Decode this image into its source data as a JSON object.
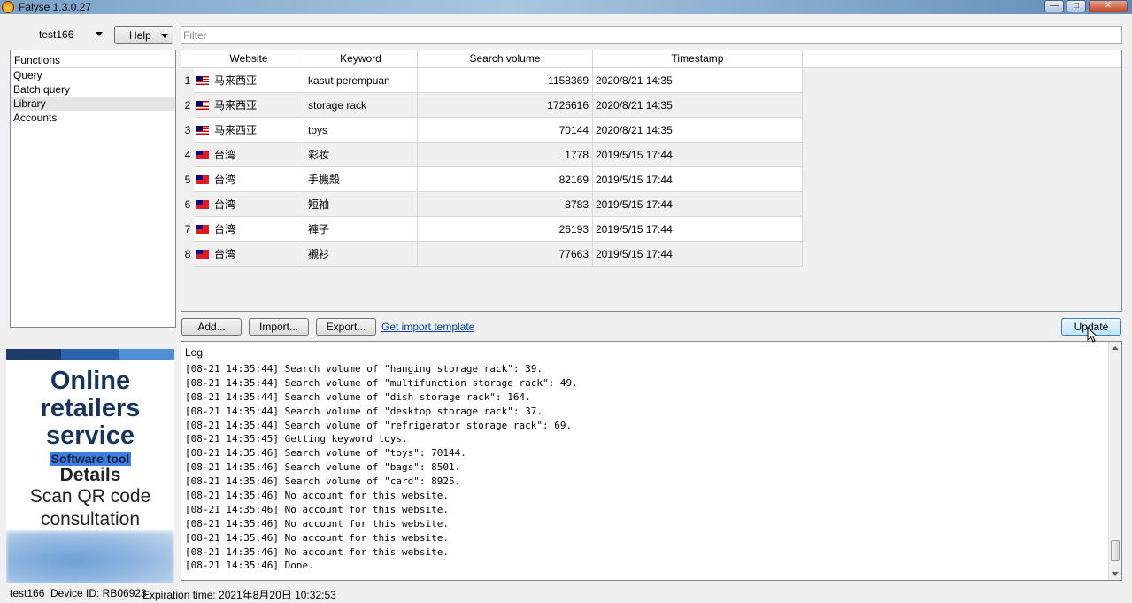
{
  "window": {
    "title": "Falyse 1.3.0.27"
  },
  "toolbar": {
    "user": "test166",
    "help_label": "Help",
    "filter_placeholder": "Filter"
  },
  "functions": {
    "header": "Functions",
    "items": [
      "Query",
      "Batch query",
      "Library",
      "Accounts"
    ],
    "selected": "Library"
  },
  "ad": {
    "line1": "Online",
    "line2": "retailers",
    "line3": "service",
    "highlight": "Software tool",
    "details": "Details",
    "scan1": "Scan QR code",
    "scan2": "consultation",
    "stripe_colors": [
      "#1c3c6c",
      "#2b64ad",
      "#4f8fd6"
    ]
  },
  "table": {
    "columns": [
      "Website",
      "Keyword",
      "Search volume",
      "Timestamp"
    ],
    "rows": [
      {
        "num": "1",
        "flag": "my",
        "website": "马来西亚",
        "keyword": "kasut perempuan",
        "volume": "1158369",
        "timestamp": "2020/8/21 14:35"
      },
      {
        "num": "2",
        "flag": "my",
        "website": "马来西亚",
        "keyword": "storage rack",
        "volume": "1726616",
        "timestamp": "2020/8/21 14:35"
      },
      {
        "num": "3",
        "flag": "my",
        "website": "马来西亚",
        "keyword": "toys",
        "volume": "70144",
        "timestamp": "2020/8/21 14:35"
      },
      {
        "num": "4",
        "flag": "tw",
        "website": "台湾",
        "keyword": "彩妆",
        "volume": "1778",
        "timestamp": "2019/5/15 17:44"
      },
      {
        "num": "5",
        "flag": "tw",
        "website": "台湾",
        "keyword": "手機殼",
        "volume": "82169",
        "timestamp": "2019/5/15 17:44"
      },
      {
        "num": "6",
        "flag": "tw",
        "website": "台湾",
        "keyword": "短袖",
        "volume": "8783",
        "timestamp": "2019/5/15 17:44"
      },
      {
        "num": "7",
        "flag": "tw",
        "website": "台湾",
        "keyword": "褲子",
        "volume": "26193",
        "timestamp": "2019/5/15 17:44"
      },
      {
        "num": "8",
        "flag": "tw",
        "website": "台湾",
        "keyword": "襯衫",
        "volume": "77663",
        "timestamp": "2019/5/15 17:44"
      }
    ]
  },
  "actions": {
    "add": "Add...",
    "import": "Import...",
    "export": "Export...",
    "template_link": "Get import template",
    "update": "Update"
  },
  "log": {
    "header": "Log",
    "lines": [
      "[08-21 14:35:44] Search volume of \"hanging storage rack\": 39.",
      "[08-21 14:35:44] Search volume of \"multifunction storage rack\": 49.",
      "[08-21 14:35:44] Search volume of \"dish storage rack\": 164.",
      "[08-21 14:35:44] Search volume of \"desktop storage rack\": 37.",
      "[08-21 14:35:44] Search volume of \"refrigerator storage rack\": 69.",
      "[08-21 14:35:45] Getting keyword toys.",
      "[08-21 14:35:46] Search volume of \"toys\": 70144.",
      "[08-21 14:35:46] Search volume of \"bags\": 8501.",
      "[08-21 14:35:46] Search volume of \"card\": 8925.",
      "[08-21 14:35:46] No account for this website.",
      "[08-21 14:35:46] No account for this website.",
      "[08-21 14:35:46] No account for this website.",
      "[08-21 14:35:46] No account for this website.",
      "[08-21 14:35:46] No account for this website.",
      "[08-21 14:35:46] Done."
    ]
  },
  "status": {
    "user": "test166",
    "device": "Device ID: RB06923",
    "expiration": "Expiration time: 2021年8月20日 10:32:53"
  }
}
